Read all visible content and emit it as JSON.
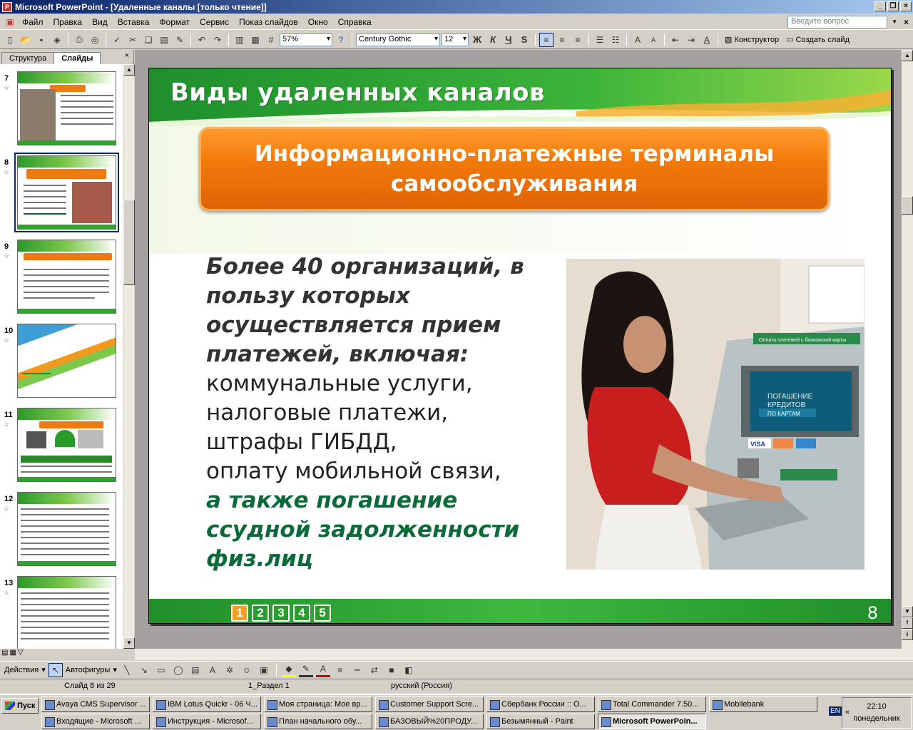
{
  "window": {
    "title": "Microsoft PowerPoint - [Удаленные каналы  [только чтение]]",
    "app_icon": "P"
  },
  "menu": [
    "Файл",
    "Правка",
    "Вид",
    "Вставка",
    "Формат",
    "Сервис",
    "Показ слайдов",
    "Окно",
    "Справка"
  ],
  "ask_placeholder": "Введите вопрос",
  "toolbar": {
    "zoom": "57%",
    "font": "Century Gothic",
    "size": "12",
    "bold": "Ж",
    "italic": "К",
    "underline": "Ч",
    "shadow": "S",
    "designer": "Конструктор",
    "new_slide": "Создать слайд"
  },
  "panel": {
    "tab_outline": "Структура",
    "tab_slides": "Слайды",
    "close": "×",
    "thumbs": [
      {
        "num": "7"
      },
      {
        "num": "8"
      },
      {
        "num": "9"
      },
      {
        "num": "10"
      },
      {
        "num": "11"
      },
      {
        "num": "12"
      },
      {
        "num": "13"
      }
    ]
  },
  "slide": {
    "title": "Виды удаленных каналов",
    "box_line1": "Информационно-платежные терминалы",
    "box_line2": "самообслуживания",
    "bold_lines": [
      "Более 40 организаций, в",
      "пользу которых",
      "осуществляется прием",
      "платежей, включая:"
    ],
    "plain_lines": [
      "коммунальные услуги,",
      "налоговые платежи,",
      "штрафы ГИБДД,",
      "оплату мобильной связи,"
    ],
    "green_lines": [
      "а также погашение",
      "ссудной задолженности",
      "физ.лиц"
    ],
    "nav": [
      "1",
      "2",
      "3",
      "4",
      "5"
    ],
    "page": "8",
    "photo_screen_line1": "ПОГАШЕНИЕ",
    "photo_screen_line2": "КРЕДИТОВ",
    "photo_screen_line3": "ПО КАРТАМ",
    "photo_header": "Оплата платежей с банковской карты",
    "photo_visa": "VISA"
  },
  "drawbar": {
    "actions": "Действия",
    "autoshapes": "Автофигуры"
  },
  "status": {
    "slide": "Слайд 8 из 29",
    "section": "1_Раздел 1",
    "lang": "русский (Россия)"
  },
  "taskbar": {
    "start": "Пуск",
    "row1": [
      "Avaya CMS Supervisor ...",
      "IBM Lotus Quickr - 06 Ч...",
      "Моя страница: Мое вр...",
      "Customer Support Scre...",
      "Сбербанк России :: О...",
      "Total Commander 7.50...",
      "Mobilebank"
    ],
    "row2": [
      "Входящие - Microsoft ...",
      "Инструкция - Microsof...",
      "План начального обу...",
      "БАЗОВЫЙ%20ПРОДУ...",
      "Безымянный - Paint",
      "Microsoft PowerPoin..."
    ],
    "lang": "EN",
    "time": "22:10",
    "day": "понедельник"
  },
  "colors": {
    "title_bar": "#0a246a",
    "slide_green": "#2ea82e",
    "orange": "#f27a0a",
    "body_green": "#0a6a3a"
  }
}
